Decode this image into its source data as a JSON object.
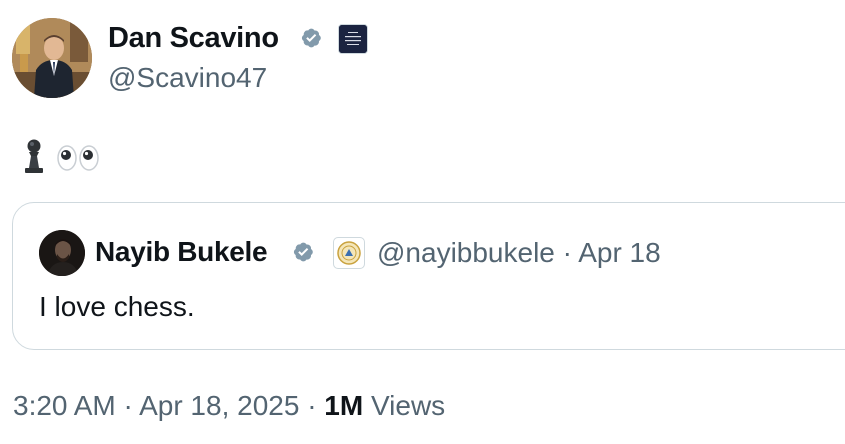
{
  "author": {
    "display_name": "Dan Scavino",
    "handle": "@Scavino47",
    "avatar_icon": "person-portrait-avatar",
    "verified_icon": "verified-badge-icon",
    "affiliation_icon": "white-house-badge-icon",
    "affiliation_text": "THE WHITE HOUSE"
  },
  "tweet": {
    "content_icons": [
      "chess-pawn-icon",
      "eyes-emoji-icon"
    ]
  },
  "quoted": {
    "display_name": "Nayib Bukele",
    "handle_date": "@nayibbukele · Apr 18",
    "text": "I love chess.",
    "verified_icon": "verified-badge-icon",
    "affiliation_icon": "el-salvador-seal-icon"
  },
  "meta": {
    "time_date": "3:20 AM · Apr 18, 2025 · ",
    "views_count": "1M",
    "views_label": " Views"
  },
  "colors": {
    "text": "#0f1419",
    "secondary": "#536471",
    "border": "#cfd9de",
    "verified_badge": "#829aab"
  }
}
